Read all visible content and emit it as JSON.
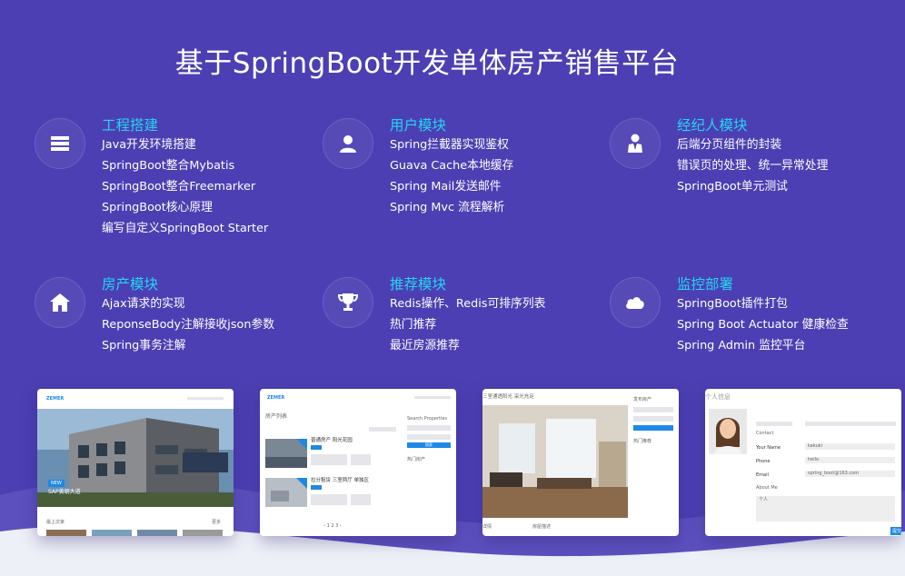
{
  "title": "基于SpringBoot开发单体房产销售平台",
  "colors": {
    "background": "#4c3fb3",
    "accent": "#22d6f0",
    "text": "#ffffff"
  },
  "features": [
    {
      "icon": "stack-icon",
      "title": "工程搭建",
      "items": [
        "Java开发环境搭建",
        "SpringBoot整合Mybatis",
        "SpringBoot整合Freemarker",
        "SpringBoot核心原理",
        "编写自定义SpringBoot Starter"
      ]
    },
    {
      "icon": "user-icon",
      "title": "用户模块",
      "items": [
        "Spring拦截器实现鉴权",
        "Guava Cache本地缓存",
        "Spring Mail发送邮件",
        "Spring Mvc 流程解析"
      ]
    },
    {
      "icon": "agent-icon",
      "title": "经纪人模块",
      "items": [
        "后端分页组件的封装",
        "错误页的处理、统一异常处理",
        "SpringBoot单元测试"
      ]
    },
    {
      "icon": "home-icon",
      "title": "房产模块",
      "items": [
        "Ajax请求的实现",
        "ReponseBody注解接收json参数",
        "Spring事务注解"
      ]
    },
    {
      "icon": "trophy-icon",
      "title": "推荐模块",
      "items": [
        "Redis操作、Redis可排序列表",
        "热门推荐",
        "最近房源推荐"
      ]
    },
    {
      "icon": "cloud-icon",
      "title": "监控部署",
      "items": [
        "SpringBoot插件打包",
        "Spring Boot Actuator 健康检查",
        "Spring Admin 监控平台"
      ]
    }
  ],
  "screenshots": {
    "home": {
      "logo": "ZEMER",
      "badge": "NEW",
      "hero_title": "SAP黄朝大道",
      "section": "最上次家",
      "more": "更多"
    },
    "list": {
      "logo": "ZEMER",
      "heading": "房产列表",
      "item1": "普通房产 阳光花园",
      "item2": "拉分租赁 三室两厅 单独区",
      "side_title": "Search Properties",
      "side_btn": "搜索",
      "side_hot": "热门房产"
    },
    "detail": {
      "heading": "三室通透阳光 采光充足",
      "side_title": "发布房产",
      "side_hot": "热门推荐",
      "tab1": "详情",
      "tab2": "房屋描述"
    },
    "profile": {
      "heading": "个人信息",
      "contact": "Contact",
      "name_label": "Your Name",
      "name_val": "kakuki",
      "phone_label": "Phone",
      "phone_val": "hello",
      "email_label": "Email",
      "email_val": "spring_boot@163.com",
      "about": "About Me",
      "about_val": "个人",
      "btn": "提交"
    }
  }
}
